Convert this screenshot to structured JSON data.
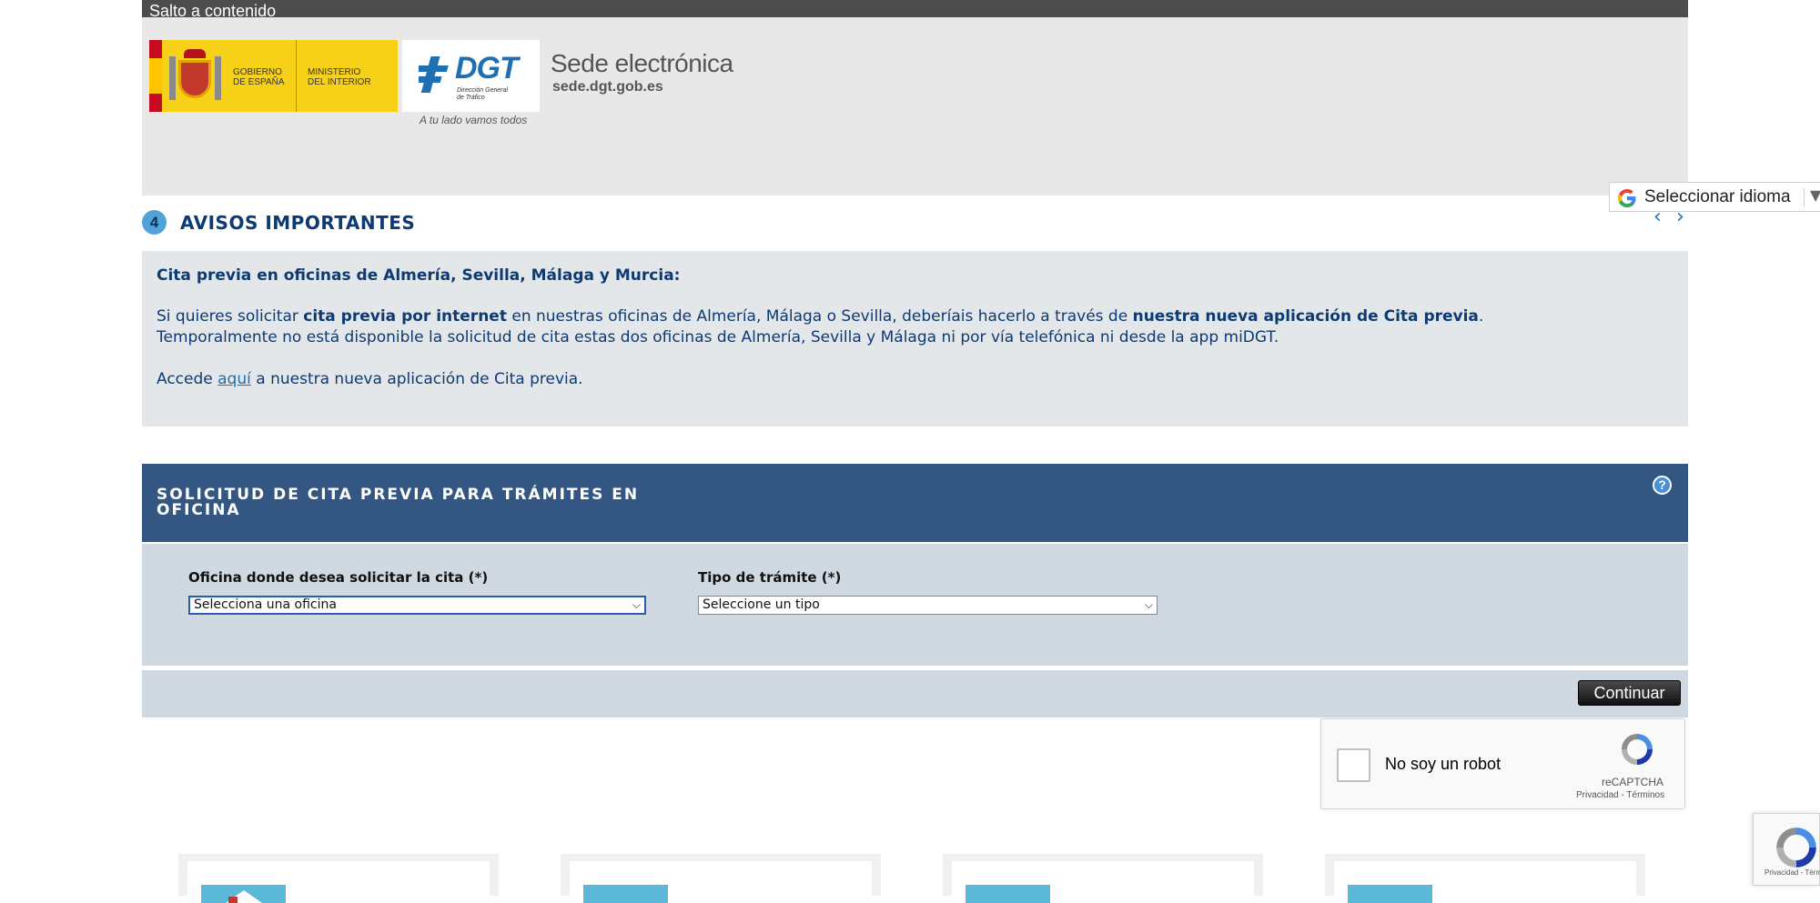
{
  "skip_link": "Salto a contenido",
  "header": {
    "gobierno_line1": "Gobierno",
    "gobierno_line2": "de España",
    "ministerio_line1": "Ministerio",
    "ministerio_line2": "del Interior",
    "dgt_logo_text": "DGT",
    "dgt_logo_sub": "Dirección General de Tráfico",
    "dgt_slogan": "A tu lado vamos todos",
    "sede_title": "Sede electrónica",
    "sede_url": "sede.dgt.gob.es",
    "language_selector": "Seleccionar idioma",
    "language_arrow": "▼"
  },
  "avisos": {
    "count": "4",
    "title": "AVISOS IMPORTANTES",
    "prev": "‹",
    "next": "›",
    "heading": "Cita previa en oficinas de Almería, Sevilla, Málaga y Murcia:",
    "line1_a": "Si quieres solicitar ",
    "line1_b": "cita previa por internet",
    "line1_c": " en nuestras oficinas de Almería, Málaga o Sevilla, deberíais hacerlo a través de ",
    "line1_d": "nuestra nueva aplicación de Cita previa",
    "line1_e": ".",
    "line2": "Temporalmente no está disponible la solicitud de cita estas dos oficinas de Almería, Sevilla y Málaga ni por vía telefónica ni desde la app miDGT.",
    "line3_a": "Accede ",
    "line3_link": "aquí",
    "line3_b": " a nuestra nueva aplicación de Cita previa."
  },
  "solicitud": {
    "title": "SOLICITUD DE CITA PREVIA PARA TRÁMITES EN OFICINA",
    "help": "?",
    "oficina_label": "Oficina donde desea solicitar la cita (*)",
    "oficina_value": "Selecciona una oficina",
    "tramite_label": "Tipo de trámite (*)",
    "tramite_value": "Seleccione un tipo",
    "continue_button": "Continuar"
  },
  "recaptcha": {
    "label": "No soy un robot",
    "brand": "reCAPTCHA",
    "links": "Privacidad - Términos",
    "badge_links": "Privacidad - Términos"
  },
  "colors": {
    "header_bg": "#e8e8e8",
    "panel_blue": "#335782",
    "panel_light": "#d0d9e1",
    "aviso_text": "#0d3a73",
    "aviso_bg": "#e3e7ea"
  }
}
